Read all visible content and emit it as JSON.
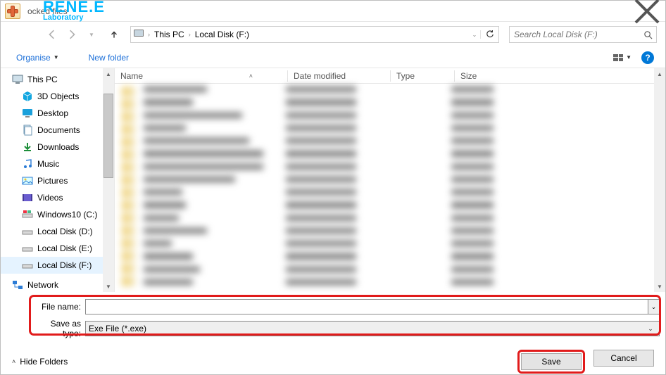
{
  "window": {
    "title": "ocked files"
  },
  "watermark": {
    "main": "RENE.E",
    "sub": "Laboratory"
  },
  "breadcrumb": {
    "items": [
      "This PC",
      "Local Disk (F:)"
    ]
  },
  "search": {
    "placeholder": "Search Local Disk (F:)"
  },
  "organise": {
    "label": "Organise",
    "new_folder": "New folder"
  },
  "tree": {
    "root": "This PC",
    "items": [
      {
        "label": "3D Objects"
      },
      {
        "label": "Desktop"
      },
      {
        "label": "Documents"
      },
      {
        "label": "Downloads"
      },
      {
        "label": "Music"
      },
      {
        "label": "Pictures"
      },
      {
        "label": "Videos"
      },
      {
        "label": "Windows10 (C:)"
      },
      {
        "label": "Local Disk (D:)"
      },
      {
        "label": "Local Disk (E:)"
      },
      {
        "label": "Local Disk (F:)",
        "selected": true
      },
      {
        "label": "Network",
        "root": true
      }
    ]
  },
  "columns": {
    "name": "Name",
    "date": "Date modified",
    "type": "Type",
    "size": "Size"
  },
  "fields": {
    "file_name_label": "File name:",
    "save_type_label": "Save as type:",
    "save_type_value": "Exe File (*.exe)"
  },
  "footer": {
    "hide_folders": "Hide Folders",
    "save": "Save",
    "cancel": "Cancel"
  }
}
